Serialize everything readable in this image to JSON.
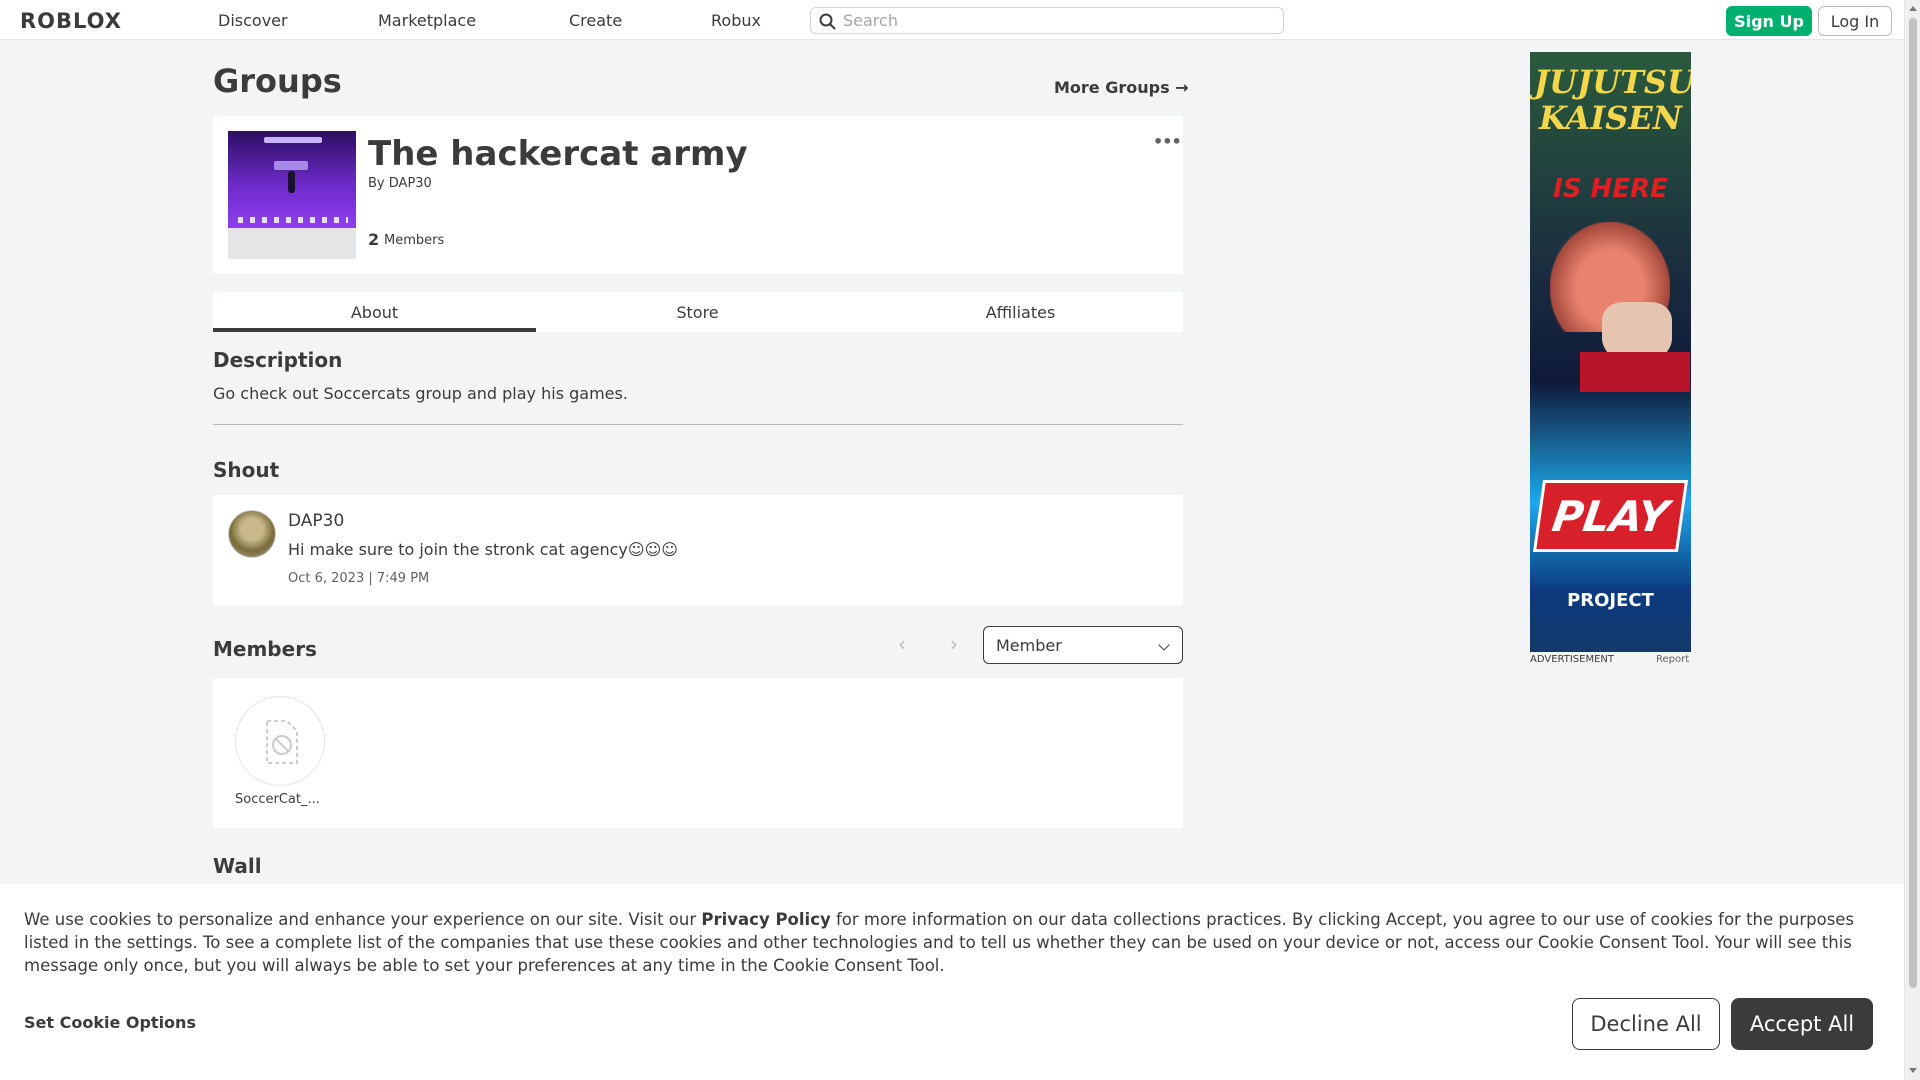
{
  "nav": {
    "logo": "ROBLOX",
    "links": [
      "Discover",
      "Marketplace",
      "Create",
      "Robux"
    ],
    "search_placeholder": "Search",
    "signup_label": "Sign Up",
    "login_label": "Log In"
  },
  "page": {
    "title": "Groups",
    "more_groups": "More Groups →"
  },
  "group": {
    "name": "The hackercat army",
    "by_prefix": "By",
    "owner": "DAP30",
    "member_count": "2",
    "member_label": "Members",
    "more_options": "•••"
  },
  "tabs": [
    "About",
    "Store",
    "Affiliates"
  ],
  "description": {
    "title": "Description",
    "text": "Go check out Soccercats group and play his games."
  },
  "shout": {
    "title": "Shout",
    "user": "DAP30",
    "message": "Hi make sure to join the stronk cat agency☺☺☺",
    "date": "Oct 6, 2023 | 7:49 PM"
  },
  "members": {
    "title": "Members",
    "prev": "‹",
    "next": "›",
    "role_selected": "Member",
    "list": [
      {
        "name": "SoccerCat_..."
      }
    ]
  },
  "wall": {
    "title": "Wall"
  },
  "ad": {
    "line1": "JUJUTSU KAISEN",
    "line2": "IS HERE",
    "play": "PLAY",
    "line3": "PROJECT",
    "label": "ADVERTISEMENT",
    "report": "Report"
  },
  "cookie": {
    "text_before": "We use cookies to personalize and enhance your experience on our site. Visit our ",
    "privacy_link": "Privacy Policy",
    "text_after": " for more information on our data collections practices. By clicking Accept, you agree to our use of cookies for the purposes listed in the settings. To see a complete list of the companies that use these cookies and other technologies and to tell us whether they can be used on your device or not, access our Cookie Consent Tool. Your will see this message only once, but you will always be able to set your preferences at any time in the Cookie Consent Tool.",
    "set_options": "Set Cookie Options",
    "decline": "Decline All",
    "accept": "Accept All"
  },
  "colors": {
    "signup_green": "#00b06f",
    "text_dark": "#393b3d",
    "page_bg": "#f2f4f5"
  }
}
